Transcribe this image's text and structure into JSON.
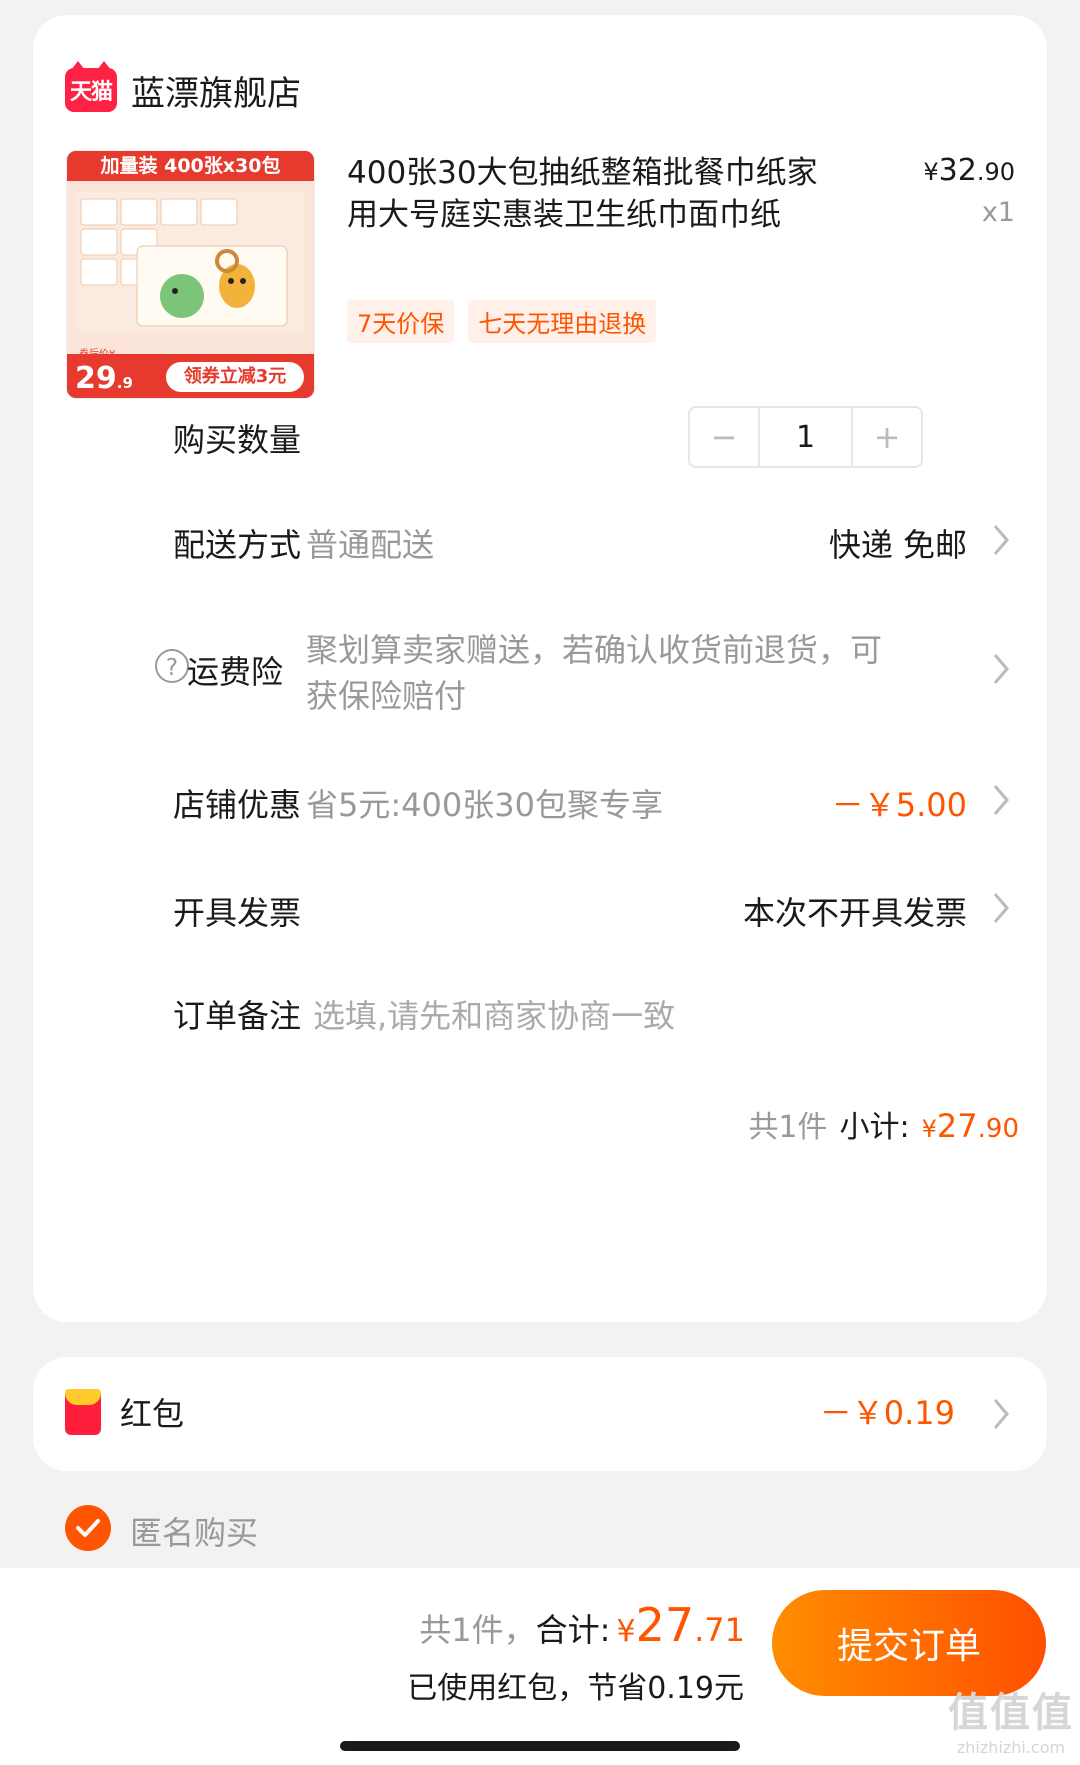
{
  "shop": {
    "logo_text": "天猫",
    "name": "蓝漂旗舰店"
  },
  "product": {
    "image": {
      "banner": "加量装 400张x30包",
      "price_label": "券后价¥",
      "price_int": "29",
      "price_dec": ".9",
      "coupon": "领券立减3元"
    },
    "title": "400张30大包抽纸整箱批餐巾纸家用大号庭实惠装卫生纸巾面巾纸",
    "price_symbol": "¥",
    "price_int": "32",
    "price_dec": ".90",
    "quantity_text": "x1",
    "tags": [
      "7天价保",
      "七天无理由退换"
    ]
  },
  "rows": {
    "quantity": {
      "label": "购买数量",
      "minus": "−",
      "value": "1",
      "plus": "+"
    },
    "delivery": {
      "label": "配送方式",
      "sub": "普通配送",
      "value": "快递 免邮"
    },
    "insurance": {
      "icon_text": "?",
      "label": "运费险",
      "sub_line1": "聚划算卖家赠送，若确认收货前退货，可",
      "sub_line2": "获保险赔付"
    },
    "discount": {
      "label": "店铺优惠",
      "sub": "省5元:400张30包聚专享",
      "value": "－￥5.00"
    },
    "invoice": {
      "label": "开具发票",
      "value": "本次不开具发票"
    },
    "note": {
      "label": "订单备注",
      "placeholder": "选填,请先和商家协商一致"
    }
  },
  "subtotal": {
    "count_text": "共1件",
    "label": "小计:",
    "symbol": "¥",
    "int": "27",
    "dec": ".90"
  },
  "redpack": {
    "label": "红包",
    "amount": "－￥0.19"
  },
  "anonymous": {
    "label": "匿名购买",
    "checked": true
  },
  "bottom": {
    "count_text": "共1件，",
    "total_label": "合计:",
    "symbol": "¥",
    "total_int": "27",
    "total_dec": ".71",
    "saved_text": "已使用红包，节省0.19元",
    "submit_label": "提交订单"
  },
  "watermark": {
    "main": "值值值",
    "sub": "zhizhizhi.com"
  },
  "colors": {
    "accent": "#ff5500",
    "tmall_red": "#ff2244",
    "button_gradient_start": "#ff8d00",
    "button_gradient_end": "#ff5000"
  }
}
